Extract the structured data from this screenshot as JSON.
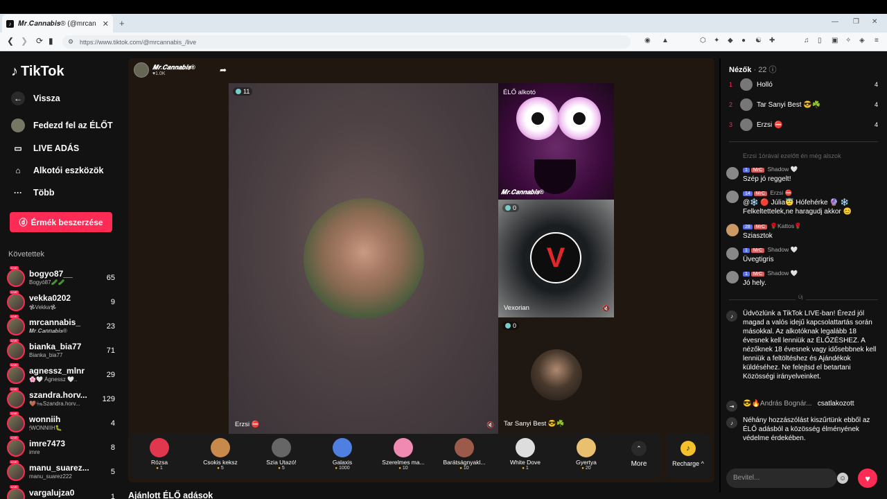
{
  "browser": {
    "tab_title": "𝑴𝒓.𝑪𝒂𝒏𝒏𝒂𝒃𝒊𝒔® (@mrcan",
    "new_tab": "+",
    "url": "https://www.tiktok.com/@mrcannabis_/live"
  },
  "sidebar": {
    "logo": "TikTok",
    "nav": [
      {
        "label": "Vissza",
        "icon": "back-arrow-icon",
        "glyph": "←"
      },
      {
        "label": "Fedezd fel az ÉLŐT",
        "icon": "avatar-icon",
        "glyph": ""
      },
      {
        "label": "LIVE ADÁS",
        "icon": "camera-icon",
        "glyph": "▭"
      },
      {
        "label": "Alkotói eszközök",
        "icon": "home-icon",
        "glyph": "⌂"
      },
      {
        "label": "Több",
        "icon": "more-icon",
        "glyph": "···"
      }
    ],
    "coins_button": "Érmék beszerzése",
    "following_header": "Követettek",
    "following": [
      {
        "name": "bogyo87__",
        "sub": "Bogyó87🥒🥒",
        "count": "65"
      },
      {
        "name": "vekka0202",
        "sub": "𖣘Vekka𖣘",
        "count": "9"
      },
      {
        "name": "mrcannabis_",
        "sub": "𝑴𝒓.𝑪𝒂𝒏𝒏𝒂𝒃𝒊𝒔®",
        "count": "23"
      },
      {
        "name": "bianka_bia77",
        "sub": "Bianka_bia77",
        "count": "71"
      },
      {
        "name": "agnessz_mlnr",
        "sub": "🌸🤍 Ágnessz 🤍..",
        "count": "29"
      },
      {
        "name": "szandra.horv...",
        "sub": "🤎🐜Szandra.horv...",
        "count": "129"
      },
      {
        "name": "wonniih",
        "sub": "🕯WONNIIH🐛",
        "count": "4"
      },
      {
        "name": "imre7473",
        "sub": "imre",
        "count": "8"
      },
      {
        "name": "manu_suarez...",
        "sub": "manu_suarez222",
        "count": "5"
      },
      {
        "name": "vargalujza0",
        "sub": "",
        "count": "1"
      }
    ]
  },
  "stream": {
    "host_name": "𝑴𝒓.𝑪𝒂𝒏𝒏𝒂𝒃𝒊𝒔®",
    "host_likes": "1.0K",
    "main_viewers": "11",
    "main_label": "Erzsi ⛔",
    "slot1_badge": "ÉLŐ alkotó",
    "slot1_label": "𝑴𝒓.𝑪𝒂𝒏𝒏𝒂𝒃𝒊𝒔®",
    "slot2_viewers": "0",
    "slot2_label": "Vexorian",
    "slot3_viewers": "0",
    "slot3_label": "Tar Sanyi Best 😎☘️"
  },
  "gifts": [
    {
      "name": "Rózsa",
      "price": "1",
      "color": "#e0374e"
    },
    {
      "name": "Csokis keksz",
      "price": "5",
      "color": "#c78a4a"
    },
    {
      "name": "Szia Utazó!",
      "price": "5",
      "color": "#666"
    },
    {
      "name": "Galaxis",
      "price": "1000",
      "color": "#4f7fe0"
    },
    {
      "name": "Szerelmes ma...",
      "price": "10",
      "color": "#f08ab3"
    },
    {
      "name": "Barátságnyakl...",
      "price": "10",
      "color": "#9c5b4a"
    },
    {
      "name": "White Dove",
      "price": "1",
      "color": "#ddd"
    },
    {
      "name": "Gyertya",
      "price": "20",
      "color": "#e8c070"
    }
  ],
  "more_label": "More",
  "recharge_label": "Recharge ^",
  "recommended": "Ajánlott ÉLŐ adások",
  "chat": {
    "viewers_title": "Nézők",
    "viewers_count": "· 22",
    "top_viewers": [
      {
        "rank": "1",
        "name": "Holló",
        "value": "4"
      },
      {
        "rank": "2",
        "name": "Tar Sanyi Best 😎☘️",
        "value": "4"
      },
      {
        "rank": "3",
        "name": "Erzsi ⛔",
        "value": "4"
      }
    ],
    "faded_line": "Erzsi 1órával ezelőtt én még alszok",
    "messages": [
      {
        "user": "Shadow 🤍",
        "level": "1",
        "club": "MrC",
        "text": "Szép jó reggelt!"
      },
      {
        "user": "Erzsi ⛔",
        "level": "14",
        "club": "MrC",
        "text": "@❄️ 🔴 Júlia😇 Hófehérke 🔮 ❄️ Felkeltettelek,ne haragudj akkor 😊"
      },
      {
        "user": "🌹Kattos🌹",
        "level": "28",
        "club": "MrC",
        "text": "Sziasztok"
      },
      {
        "user": "Shadow 🤍",
        "level": "1",
        "club": "MrC",
        "text": "Üvegtigris"
      },
      {
        "user": "Shadow 🤍",
        "level": "1",
        "club": "MrC",
        "text": "Jó hely."
      }
    ],
    "new_divider": "Új",
    "welcome": "Üdvözlünk a TikTok LIVE-ban! Érezd jól magad a valós idejű kapcsolattartás során másokkal. Az alkotóknak legalább 18 évesnek kell lenniük az ÉLŐZÉSHEZ. A nézőknek 18 évesnek vagy idősebbnek kell lenniük a feltöltéshez és Ajándékok küldéséhez. Ne felejtsd el betartani Közösségi irányelveinket.",
    "join_user": "😎🔥András Bognár...",
    "join_text": "csatlakozott",
    "filter_notice": "Néhány hozzászólást kiszűrtünk ebből az ÉLŐ adásból a közösség élményének védelme érdekében.",
    "input_placeholder": "Bevitel..."
  }
}
